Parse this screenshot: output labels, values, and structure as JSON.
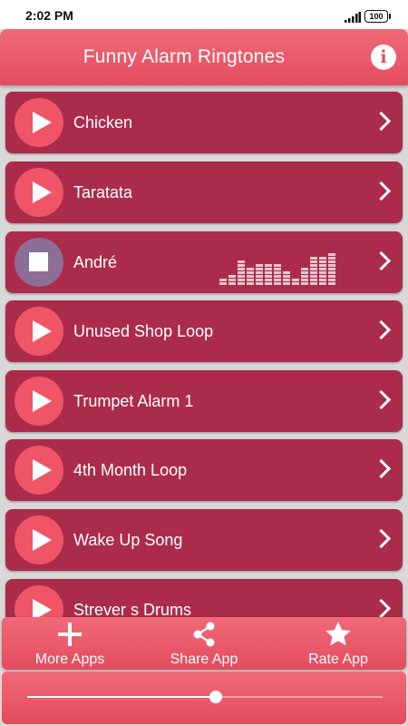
{
  "status_bar": {
    "time": "2:02 PM",
    "battery": "100"
  },
  "header": {
    "title": "Funny Alarm Ringtones",
    "info_icon": "info-icon"
  },
  "ringtones": [
    {
      "label": "Chicken",
      "state": "play"
    },
    {
      "label": "Taratata",
      "state": "play"
    },
    {
      "label": "André",
      "state": "playing"
    },
    {
      "label": "Unused Shop Loop",
      "state": "play"
    },
    {
      "label": "Trumpet Alarm 1",
      "state": "play"
    },
    {
      "label": "4th Month Loop",
      "state": "play"
    },
    {
      "label": "Wake Up Song",
      "state": "play"
    },
    {
      "label": "Strever s Drums",
      "state": "play"
    }
  ],
  "bottom_bar": {
    "more_apps": "More Apps",
    "share_app": "Share App",
    "rate_app": "Rate App"
  },
  "seek_bar": {
    "progress": 0.53
  },
  "colors": {
    "accent": "#e94f61",
    "item_bg": "#ab2c4a",
    "play_button": "#ef5567",
    "page_bg": "#d8d8d8"
  }
}
